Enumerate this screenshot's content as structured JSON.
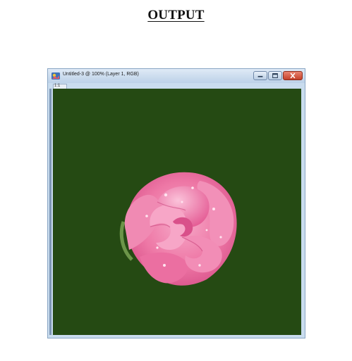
{
  "heading": "OUTPUT",
  "window": {
    "title": "Untitled-3 @ 100% (Layer 1, RGB)",
    "tab_label": "1:1",
    "canvas_color": "#254a13",
    "close_color": "#c4412a"
  },
  "icons": [
    "app-icon",
    "minimize-icon",
    "maximize-icon",
    "close-icon"
  ],
  "image": {
    "subject_colors": [
      "#f07aa8",
      "#e85c93",
      "#f6a9c8"
    ]
  }
}
